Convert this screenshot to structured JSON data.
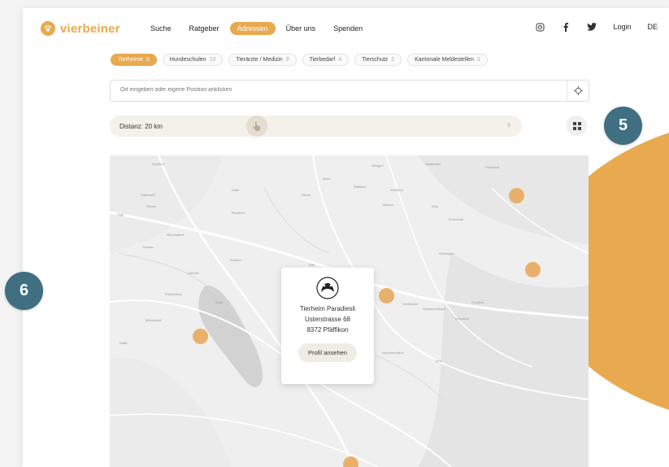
{
  "brand": {
    "name": "vierbeiner",
    "accent": "#e8a94f"
  },
  "nav": {
    "items": [
      {
        "label": "Suche"
      },
      {
        "label": "Ratgeber"
      },
      {
        "label": "Adressen"
      },
      {
        "label": "Über uns"
      },
      {
        "label": "Spenden"
      }
    ],
    "active": "Adressen"
  },
  "header_right": {
    "icons": [
      "instagram-icon",
      "facebook-icon",
      "twitter-icon"
    ],
    "login": "Login",
    "language": "DE"
  },
  "categories": [
    {
      "label": "Tierheime",
      "count": "5"
    },
    {
      "label": "Hundeschulen",
      "count": "10"
    },
    {
      "label": "Tierärzte / Medizin",
      "count": "9"
    },
    {
      "label": "Tierbedarf",
      "count": "4"
    },
    {
      "label": "Tierschutz",
      "count": "2"
    },
    {
      "label": "Kantonale Meldestellen",
      "count": "2"
    }
  ],
  "search": {
    "placeholder": "Ort eingeben oder eigene Position anklicken"
  },
  "distance": {
    "label": "Distanz: 20 km",
    "max_label": "5"
  },
  "map": {
    "labels": [
      "Dietlikon",
      "Wangen",
      "Wallisellen",
      "Fehraltorf",
      "Volketswil",
      "Uster",
      "Maur",
      "Pfäffikon",
      "Wetzikon",
      "Hinwil",
      "Hittnau",
      "Bauma",
      "Wila",
      "Turbenthal",
      "Russikon",
      "Egg",
      "Mönchaltorf",
      "Gossau",
      "Grüningen",
      "Dürnten",
      "Bubikon",
      "Rüti",
      "Fischenthal",
      "Wald",
      "Greifensee",
      "Schwerzenbach",
      "Zumikon",
      "Küsnacht",
      "Männedorf",
      "Stäfa",
      "Hombrechtikon",
      "Jona"
    ],
    "popup": {
      "name": "Tierheim Paradiesli",
      "street": "Usterstrasse 68",
      "city": "8372 Pfäffikon",
      "button": "Profil ansehen"
    }
  },
  "annotations": {
    "badge_a": "5",
    "badge_b": "6",
    "badge_color": "#3f6f80"
  }
}
